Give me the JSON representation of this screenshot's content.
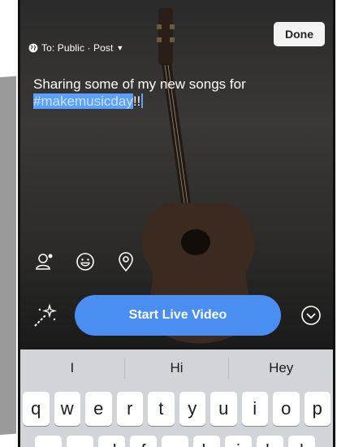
{
  "header": {
    "audience_text": "To: Public · Post",
    "done_label": "Done"
  },
  "composer": {
    "text": "Sharing some of my new songs for",
    "hashtag": "#makemusicday",
    "suffix": "!!"
  },
  "tools": [
    {
      "icon": "tag-people-icon"
    },
    {
      "icon": "emoji-icon"
    },
    {
      "icon": "location-pin-icon"
    }
  ],
  "actions": {
    "start_live_label": "Start Live Video",
    "magic_icon": "magic-wand-icon",
    "collapse_icon": "chevron-down-circle-icon"
  },
  "keyboard": {
    "suggestions": [
      "I",
      "Hi",
      "Hey"
    ],
    "row1": [
      "q",
      "w",
      "e",
      "r",
      "t",
      "y",
      "u",
      "i",
      "o",
      "p"
    ],
    "row2": [
      "a",
      "s",
      "d",
      "f",
      "g",
      "h",
      "j",
      "k",
      "l"
    ]
  },
  "colors": {
    "accent": "#4a8ef2",
    "selection": "#5aa0ff",
    "keyboard_bg": "#d1d4d9"
  }
}
